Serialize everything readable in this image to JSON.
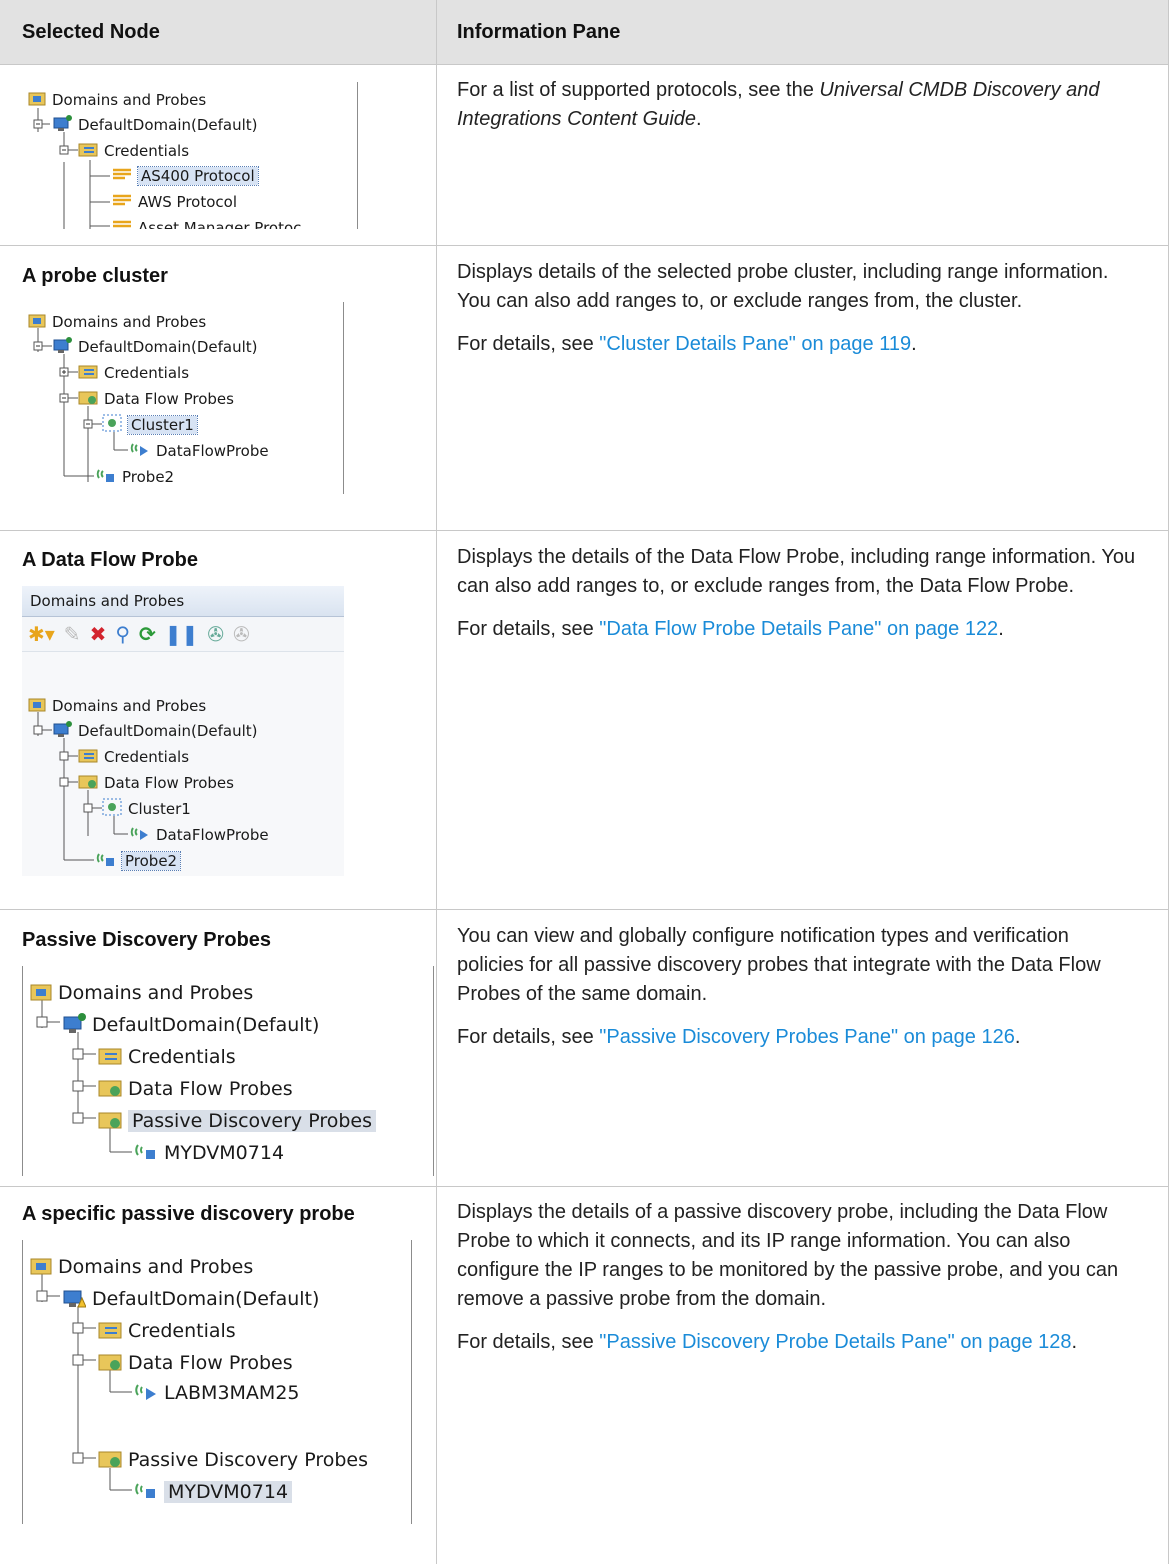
{
  "header": {
    "selected_node": "Selected Node",
    "information_pane": "Information Pane"
  },
  "rows": [
    {
      "title": "",
      "tree": [
        "Domains and Probes",
        "DefaultDomain(Default)",
        "Credentials",
        "AS400 Protocol",
        "AWS Protocol",
        "Asset Manager Protoc"
      ],
      "p1_before": "For a list of supported protocols, see the ",
      "p1_italic": "Universal CMDB Discovery and Integrations Content Guide",
      "p1_after": "."
    },
    {
      "title": "A probe cluster",
      "tree": [
        "Domains and Probes",
        "DefaultDomain(Default)",
        "Credentials",
        "Data Flow Probes",
        "Cluster1",
        "DataFlowProbe",
        "Probe2"
      ],
      "p1": "Displays details of the selected probe cluster, including range information. You can also add ranges to, or exclude ranges from, the cluster.",
      "p2_prefix": "For details, see ",
      "p2_link": "\"Cluster Details Pane\" on page 119",
      "p2_suffix": "."
    },
    {
      "title": "A Data Flow Probe",
      "toolbar_title": "Domains and Probes",
      "tree": [
        "Domains and Probes",
        "DefaultDomain(Default)",
        "Credentials",
        "Data Flow Probes",
        "Cluster1",
        "DataFlowProbe",
        "Probe2"
      ],
      "p1": "Displays the details of the Data Flow Probe, including range information. You can also add ranges to, or exclude ranges from, the Data Flow Probe.",
      "p2_prefix": "For details, see ",
      "p2_link": "\"Data Flow Probe Details Pane\" on page 122",
      "p2_suffix": "."
    },
    {
      "title": "Passive Discovery Probes",
      "tree": [
        "Domains and Probes",
        "DefaultDomain(Default)",
        "Credentials",
        "Data Flow Probes",
        "Passive Discovery Probes",
        "MYDVM0714"
      ],
      "p1": "You can view and globally configure notification types and verification policies for all passive discovery probes that integrate with the Data Flow Probes of the same domain.",
      "p2_prefix": "For details, see ",
      "p2_link": "\"Passive Discovery Probes Pane\" on page 126",
      "p2_suffix": "."
    },
    {
      "title": "A specific passive discovery probe",
      "tree": [
        "Domains and Probes",
        "DefaultDomain(Default)",
        "Credentials",
        "Data Flow Probes",
        "LABM3MAM25",
        "Passive Discovery Probes",
        "MYDVM0714"
      ],
      "p1": "Displays the details of a passive discovery probe, including the Data Flow Probe to which it connects, and its IP range information. You can also configure the IP ranges to be monitored by the passive probe, and you can remove a passive probe from the domain.",
      "p2_prefix": "For details, see ",
      "p2_link": "\"Passive Discovery Probe Details Pane\" on page 128",
      "p2_suffix": "."
    }
  ],
  "colors": {
    "link": "#1a8bd8",
    "header_bg": "#e2e2e2",
    "selection": "#d7e3f4"
  },
  "icons": [
    "domain-folder-icon",
    "computer-icon",
    "credentials-folder-icon",
    "protocol-icon",
    "probes-folder-icon",
    "cluster-icon",
    "probe-icon",
    "new-icon",
    "edit-icon",
    "delete-icon",
    "search-icon",
    "refresh-icon",
    "pause-icon"
  ]
}
